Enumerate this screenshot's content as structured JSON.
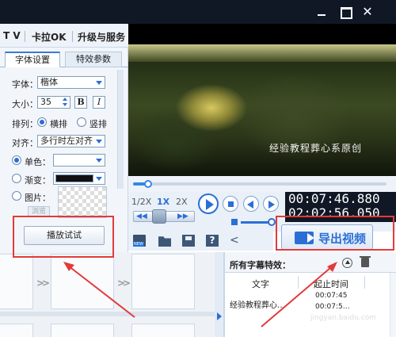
{
  "window": {
    "close_glyph": "✕"
  },
  "menu": {
    "items": [
      "T V",
      "卡拉OK",
      "升级与服务"
    ]
  },
  "subtitle_panel": {
    "tabs": [
      "字体设置",
      "特效参数"
    ],
    "font_label": "字体：",
    "font_value": "楷体",
    "size_label": "大小：",
    "size_value": "35",
    "bold_label": "B",
    "italic_label": "I",
    "arrange_label": "排列：",
    "arrange_options": [
      "横排",
      "竖排"
    ],
    "arrange_selected": "横排",
    "align_label": "对齐：",
    "align_value": "多行时左对齐",
    "solid_label": "单色：",
    "gradient_label": "渐变：",
    "image_label": "图片：",
    "browse_label": "浏览",
    "preview_button": "播放试试"
  },
  "video": {
    "watermark": "经验教程葬心系原创",
    "progress": 0.06
  },
  "playback": {
    "speeds": [
      "1/2X",
      "1X",
      "2X"
    ],
    "active_speed": "1X",
    "current_time": "00:07:46.880",
    "total_time": "02:02:56.050",
    "volume": 0.9
  },
  "toolbar": {
    "icons": [
      "new-icon",
      "open-folder-icon",
      "save-icon",
      "help-icon",
      "share-icon"
    ],
    "help_glyph": "?",
    "share_glyph": "<"
  },
  "export": {
    "label": "导出视频"
  },
  "effects": {
    "title": "所有字幕特效：",
    "columns": [
      "文字",
      "起止时间"
    ],
    "rows": [
      {
        "text": "经验教程葬心…",
        "start": "00:07:45",
        "end": "00:07:5…"
      }
    ]
  },
  "site_watermark": "jingyan.baidu.com",
  "colors": {
    "accent": "#2b6fd6",
    "annotation": "#e33a3a",
    "titlebar": "#101826"
  }
}
